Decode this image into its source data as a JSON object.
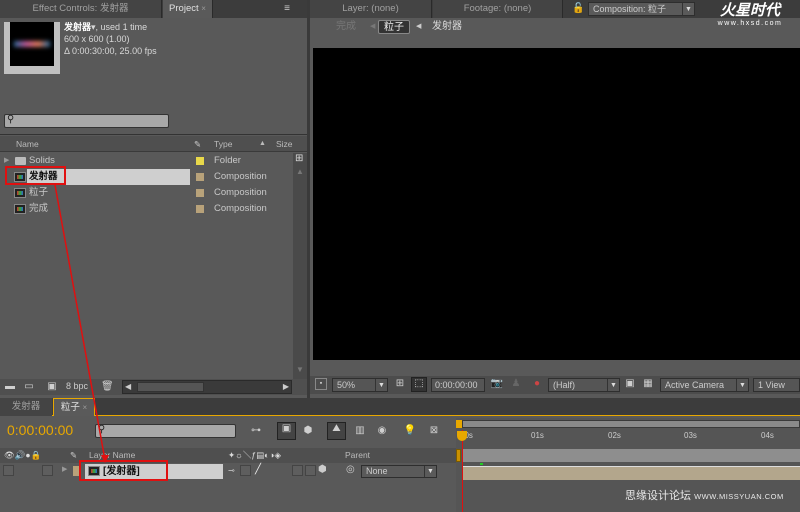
{
  "project_panel": {
    "tabs": [
      {
        "label": "Effect Controls: 发射器",
        "active": false
      },
      {
        "label": "Project",
        "active": true
      }
    ],
    "preview": {
      "name": "发射器",
      "used": ", used 1 time",
      "dimensions": "600 x 600 (1.00)",
      "duration": "Δ 0:00:30:00, 25.00 fps"
    },
    "search_placeholder": "",
    "columns": {
      "name": "Name",
      "type": "Type",
      "size": "Size"
    },
    "items": [
      {
        "name": "Solids",
        "type": "Folder",
        "kind": "folder",
        "label_color": "#e8d84a",
        "selected": false
      },
      {
        "name": "发射器",
        "type": "Composition",
        "kind": "composition",
        "label_color": "#b8a27a",
        "selected": true
      },
      {
        "name": "粒子",
        "type": "Composition",
        "kind": "composition",
        "label_color": "#b8a27a",
        "selected": false
      },
      {
        "name": "完成",
        "type": "Composition",
        "kind": "composition",
        "label_color": "#b8a27a",
        "selected": false
      }
    ],
    "footer": {
      "bpc": "8 bpc"
    }
  },
  "viewer_panel": {
    "tabs": [
      {
        "label": "Layer: (none)"
      },
      {
        "label": "Footage: (none)"
      },
      {
        "label": "Composition: 粒子"
      }
    ],
    "breadcrumbs": [
      "完成",
      "粒子",
      "发射器"
    ],
    "active_breadcrumb": "粒子",
    "watermark": {
      "brand": "火星时代",
      "url": "www.hxsd.com"
    },
    "toolbar": {
      "zoom": "50%",
      "timecode": "0:00:00:00",
      "resolution": "(Half)",
      "camera": "Active Camera",
      "views": "1 View"
    }
  },
  "timeline_panel": {
    "tabs": [
      {
        "label": "发射器",
        "active": false
      },
      {
        "label": "粒子",
        "active": true
      }
    ],
    "timecode": "0:00:00:00",
    "search_placeholder": "",
    "columns": {
      "layer_name": "Layer Name",
      "parent": "Parent"
    },
    "layers": [
      {
        "name": "[发射器]",
        "parent": "None"
      }
    ],
    "ruler": [
      "00s",
      "01s",
      "02s",
      "03s",
      "04s"
    ],
    "watermark": {
      "text": "思缘设计论坛",
      "url": "WWW.MISSYUAN.COM"
    }
  },
  "colors": {
    "accent": "#e8a800",
    "highlight": "#e01010",
    "playhead": "#e01010"
  }
}
